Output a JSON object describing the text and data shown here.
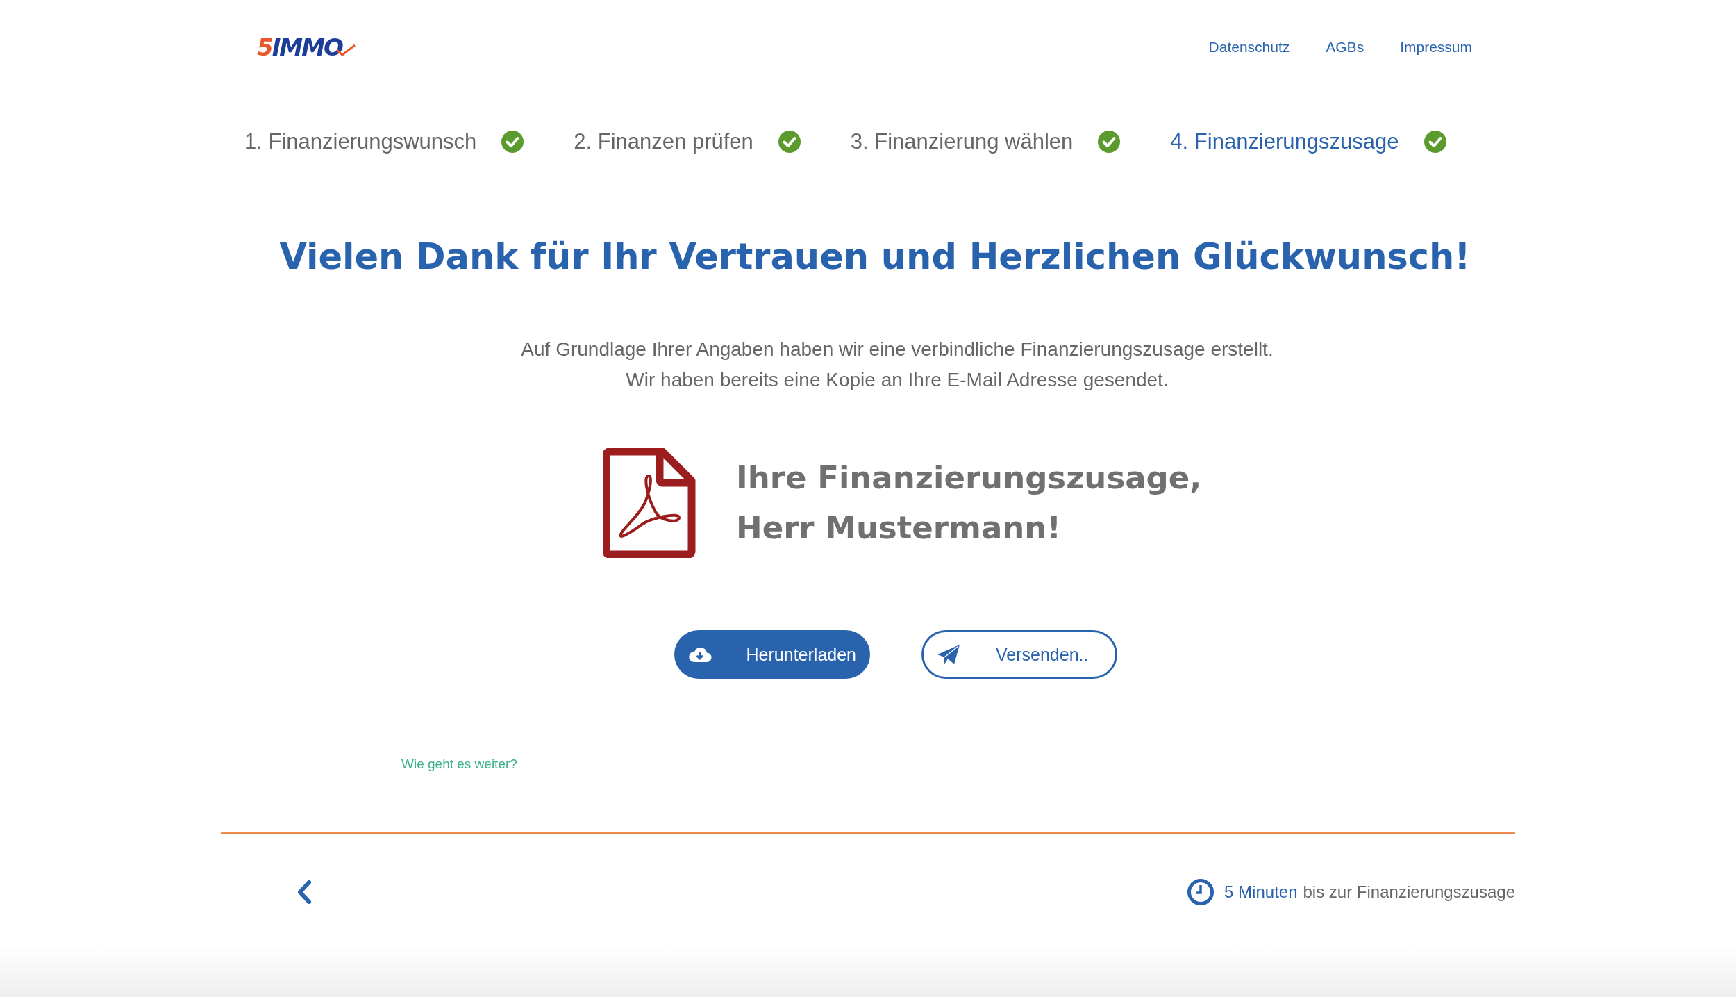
{
  "header": {
    "logo": {
      "digit": "5",
      "word": "IMMO"
    },
    "nav": [
      "Datenschutz",
      "AGBs",
      "Impressum"
    ]
  },
  "steps": [
    {
      "label": "1. Finanzierungswunsch",
      "done": true,
      "selected": false
    },
    {
      "label": "2. Finanzen prüfen",
      "done": true,
      "selected": false
    },
    {
      "label": "3. Finanzierung wählen",
      "done": true,
      "selected": false
    },
    {
      "label": "4. Finanzierungszusage",
      "done": true,
      "selected": true
    }
  ],
  "headline": "Vielen Dank für Ihr Vertrauen und Herzlichen Glückwunsch!",
  "intro": [
    "Auf Grundlage Ihrer Angaben haben wir eine verbindliche Finanzierungszusage erstellt.",
    "Wir haben bereits eine Kopie an Ihre E-Mail Adresse gesendet."
  ],
  "document": {
    "title_lines": [
      "Ihre Finanzierungszusage,",
      "Herr Mustermann!"
    ]
  },
  "buttons": [
    {
      "kind": "download",
      "label": "Herunterladen"
    },
    {
      "kind": "send",
      "label": "Versenden.."
    }
  ],
  "next_link": "Wie geht es weiter?",
  "footer": {
    "time_highlight": "5 Minuten",
    "time_rest": "bis zur Finanzierungszusage"
  }
}
